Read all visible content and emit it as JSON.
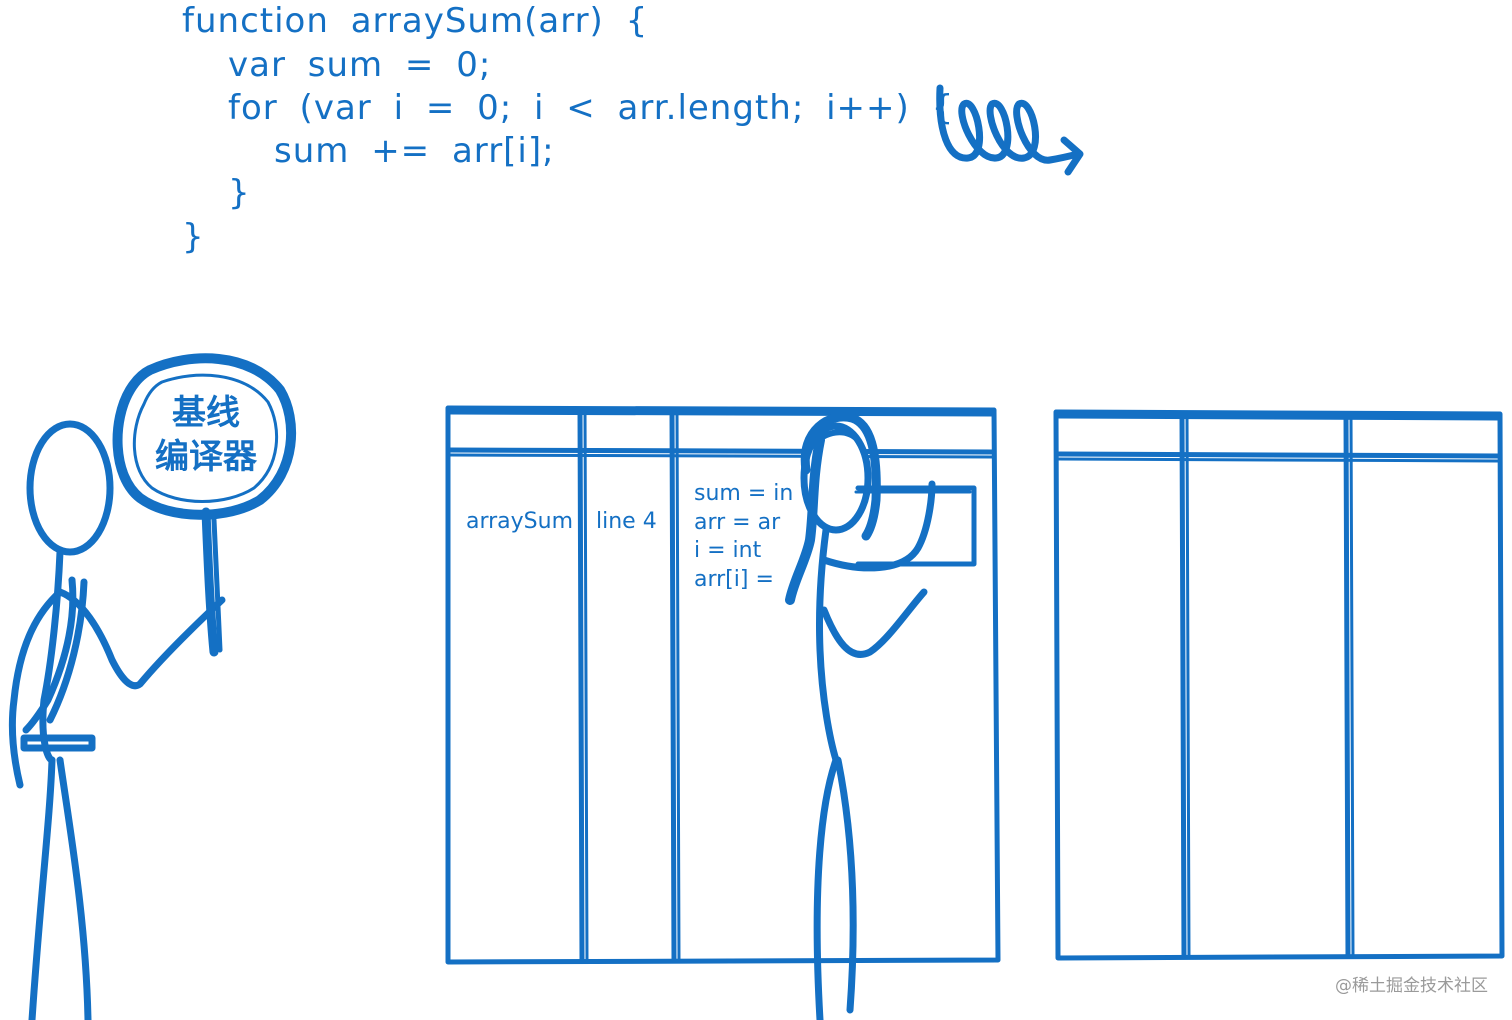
{
  "code": {
    "lines": [
      "function arraySum(arr) {",
      "var sum = 0;",
      "for (var i = 0; i < arr.length; i++) {",
      "sum += arr[i];",
      "}",
      "}"
    ]
  },
  "sign": {
    "line1": "基线",
    "line2": "编译器"
  },
  "stack_table": {
    "function_name": "arraySum",
    "line_label": "line 4",
    "variables": [
      "sum = in",
      "arr = ar",
      "i = int",
      "arr[i] ="
    ]
  },
  "watermark": "@稀土掘金技术社区",
  "colors": {
    "ink": "#1470c4",
    "background": "#ffffff",
    "watermark": "#9a9a9a"
  },
  "icons": {
    "loop_scribble": "loop-arrow-icon",
    "sign": "lollipop-sign"
  }
}
